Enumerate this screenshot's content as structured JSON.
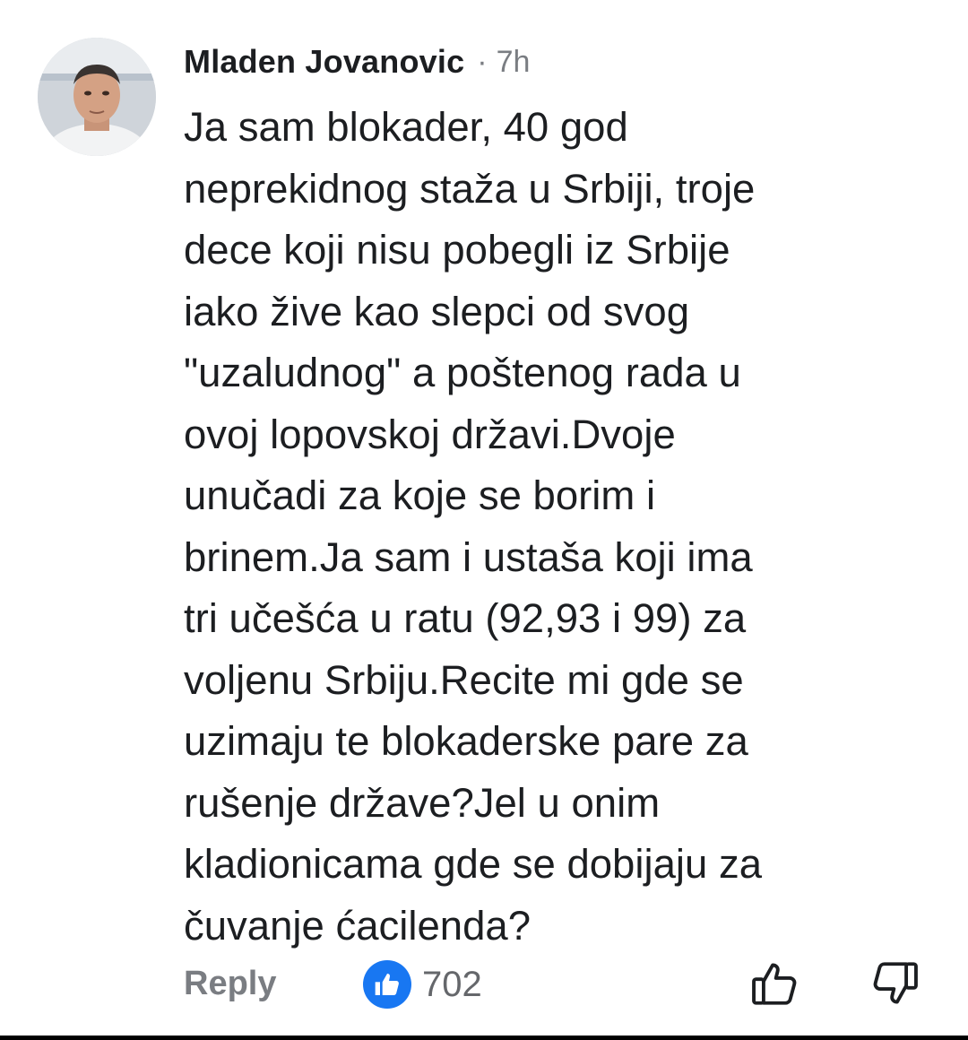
{
  "comment": {
    "author": "Mladen Jovanovic",
    "separator": "·",
    "time": "7h",
    "lines": [
      "Ja sam blokader, 40 god",
      "neprekidnog staža u Srbiji, troje",
      "dece koji nisu pobegli iz Srbije",
      "iako žive kao slepci od svog",
      "\"uzaludnog\" a poštenog rada u",
      "ovoj lopovskoj državi.Dvoje",
      "unučadi za koje se borim i",
      "brinem.Ja sam i ustaša koji ima",
      "tri učešća u ratu (92,93 i 99) za",
      "voljenu Srbiju.Recite mi gde se",
      "uzimaju te blokaderske pare za",
      "rušenje države?Jel u onim",
      "kladionicama gde se dobijaju za",
      "čuvanje ćacilenda?"
    ]
  },
  "actions": {
    "reply_label": "Reply",
    "reaction_count": "702",
    "reaction_icon": "like-icon",
    "upvote_icon": "thumbs-up-outline-icon",
    "downvote_icon": "thumbs-down-outline-icon"
  },
  "colors": {
    "like_blue": "#1877f2",
    "secondary_text": "#7a7d82",
    "primary_text": "#1c1e21"
  }
}
